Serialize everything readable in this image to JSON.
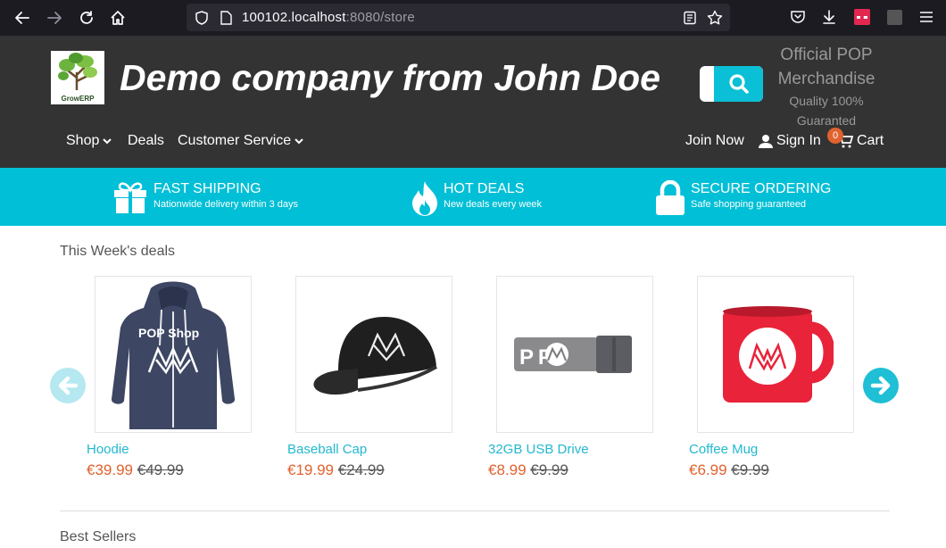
{
  "browser": {
    "url_host": "100102.localhost",
    "url_rest": ":8080/store"
  },
  "header": {
    "logo_caption": "GrowERP",
    "company_title": "Demo company from John Doe",
    "slogan_line1": "Official POP",
    "slogan_line2": "Merchandise",
    "slogan_line3": "Quality 100%",
    "slogan_line4": "Guaranted"
  },
  "menu": {
    "shop": "Shop",
    "deals": "Deals",
    "customer_service": "Customer Service",
    "join": "Join Now",
    "sign_in": "Sign In",
    "cart": "Cart",
    "cart_count": "0"
  },
  "features": [
    {
      "title": "FAST SHIPPING",
      "subtitle": "Nationwide delivery within 3 days",
      "icon": "gift-icon"
    },
    {
      "title": "HOT DEALS",
      "subtitle": "New deals every week",
      "icon": "fire-icon"
    },
    {
      "title": "SECURE ORDERING",
      "subtitle": "Safe shopping guaranteed",
      "icon": "lock-icon"
    }
  ],
  "deals": {
    "title": "This Week's deals",
    "products": [
      {
        "name": "Hoodie",
        "price": "€39.99",
        "old_price": "€49.99",
        "image_text": "POP Shop"
      },
      {
        "name": "Baseball Cap",
        "price": "€19.99",
        "old_price": "€24.99"
      },
      {
        "name": "32GB USB Drive",
        "price": "€8.99",
        "old_price": "€9.99",
        "image_text": "P P"
      },
      {
        "name": "Coffee Mug",
        "price": "€6.99",
        "old_price": "€9.99"
      }
    ]
  },
  "best_sellers": {
    "title": "Best Sellers"
  },
  "colors": {
    "accent": "#00bfd6",
    "price": "#e0622f",
    "header_bg": "#333333"
  }
}
